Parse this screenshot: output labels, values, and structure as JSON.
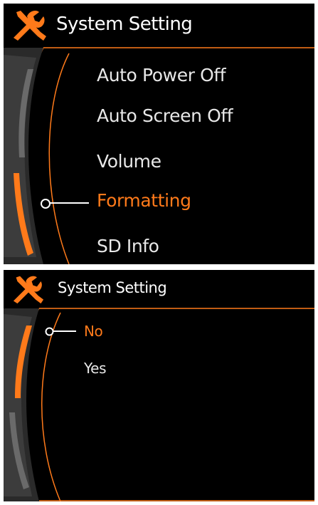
{
  "screen1": {
    "title": "System Setting",
    "menu_items": [
      {
        "label": "Auto Power Off",
        "selected": false
      },
      {
        "label": "Auto Screen Off",
        "selected": false
      },
      {
        "label": "Volume",
        "selected": false
      },
      {
        "label": "Formatting",
        "selected": true
      },
      {
        "label": "SD Info",
        "selected": false
      }
    ]
  },
  "screen2": {
    "title": "System Setting",
    "options": [
      {
        "label": "No",
        "selected": true
      },
      {
        "label": "Yes",
        "selected": false
      }
    ]
  },
  "colors": {
    "accent": "#ff7a1a",
    "background": "#000000",
    "text": "#e8e8e8"
  },
  "icons": [
    "wrench-screwdriver-icon",
    "selector-dot-icon"
  ]
}
